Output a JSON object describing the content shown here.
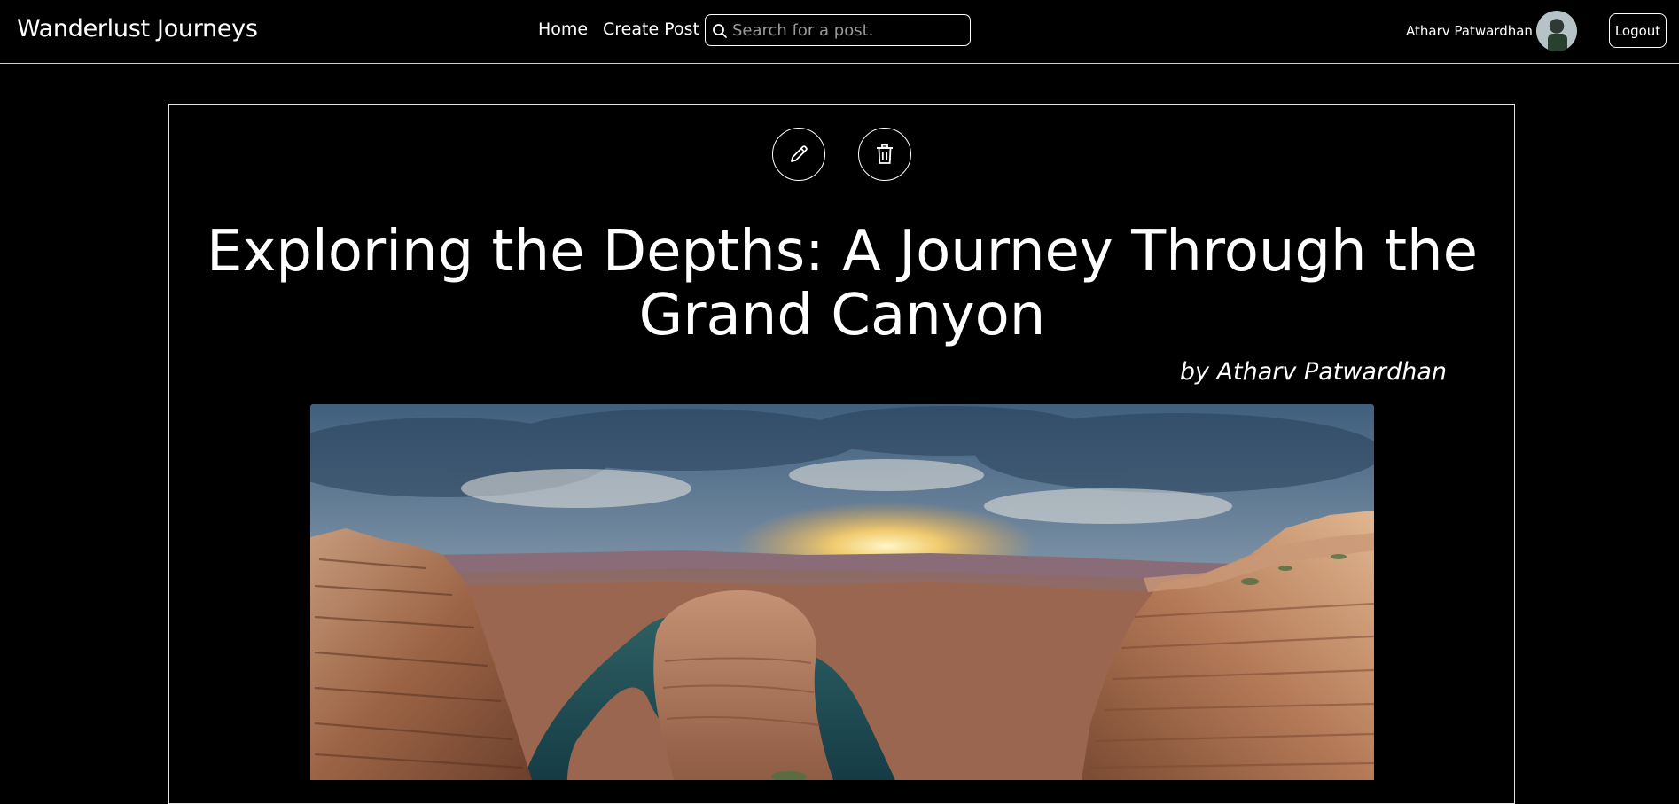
{
  "navbar": {
    "brand": "Wanderlust Journeys",
    "links": {
      "home": "Home",
      "create_post": "Create Post"
    },
    "search": {
      "placeholder": "Search for a post.",
      "value": ""
    },
    "user": {
      "name": "Atharv Patwardhan"
    },
    "logout_label": "Logout"
  },
  "post": {
    "title": "Exploring the Depths: A Journey Through the Grand Canyon",
    "byline": "by Atharv Patwardhan",
    "actions": {
      "edit_icon": "pencil-icon",
      "delete_icon": "trash-icon"
    },
    "image": {
      "subject": "Horseshoe Bend canyon at sunset"
    }
  },
  "colors": {
    "background": "#000000",
    "text": "#ffffff",
    "border": "#e3e3e3"
  }
}
